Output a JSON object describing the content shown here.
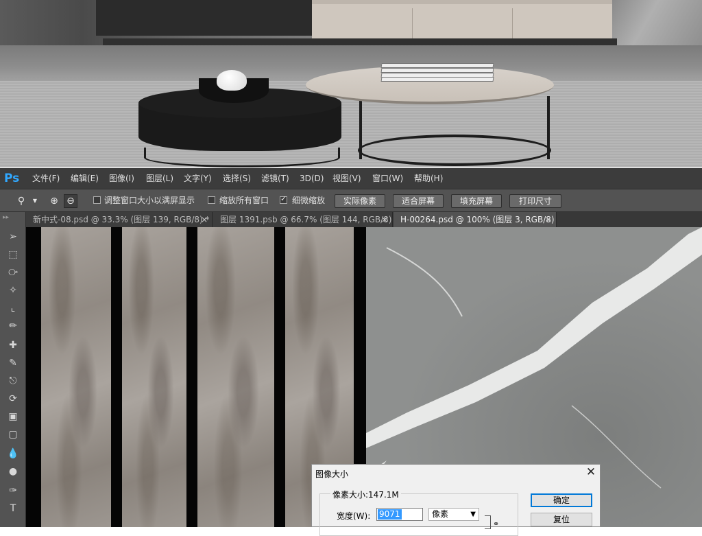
{
  "photoshop": {
    "logo": "Ps",
    "menu": [
      "文件(F)",
      "编辑(E)",
      "图像(I)",
      "图层(L)",
      "文字(Y)",
      "选择(S)",
      "滤镜(T)",
      "3D(D)",
      "视图(V)",
      "窗口(W)",
      "帮助(H)"
    ],
    "options_bar": {
      "check_resize_windows": {
        "label": "调整窗口大小以满屏显示",
        "checked": false
      },
      "check_zoom_all": {
        "label": "缩放所有窗口",
        "checked": false
      },
      "check_scrubby": {
        "label": "细微缩放",
        "checked": true
      },
      "buttons": [
        "实际像素",
        "适合屏幕",
        "填充屏幕",
        "打印尺寸"
      ]
    },
    "tabs": [
      {
        "label": "新中式-08.psd @ 33.3% (图层 139, RGB/8) *",
        "close": "×",
        "active": false
      },
      {
        "label": "图层 1391.psb @ 66.7% (图层 144, RGB/8)",
        "close": "×",
        "active": false
      },
      {
        "label": "H-00264.psd @ 100% (图层 3, RGB/8)",
        "close": "×",
        "active": true
      }
    ]
  },
  "dialog": {
    "title": "图像大小",
    "close_glyph": "✕",
    "pixel_size_label": "像素大小:147.1M",
    "width_label": "宽度(W):",
    "width_value": "9071",
    "width_unit": "像素",
    "ok_label": "确定",
    "reset_label": "复位"
  },
  "icons": {
    "zoom_tool": "magnifier-icon",
    "zoom_in": "zoom-in-icon",
    "zoom_out": "zoom-out-icon",
    "tools": [
      "move-icon",
      "marquee-icon",
      "lasso-icon",
      "magic-wand-icon",
      "crop-icon",
      "eyedropper-icon",
      "healing-brush-icon",
      "brush-icon",
      "clone-stamp-icon",
      "history-brush-icon",
      "eraser-icon",
      "gradient-icon",
      "blur-icon",
      "dodge-icon",
      "pen-icon",
      "type-icon"
    ]
  },
  "colors": {
    "ps_logo": "#31a8ff",
    "menubar": "#3c3c3c",
    "panel": "#535353"
  }
}
